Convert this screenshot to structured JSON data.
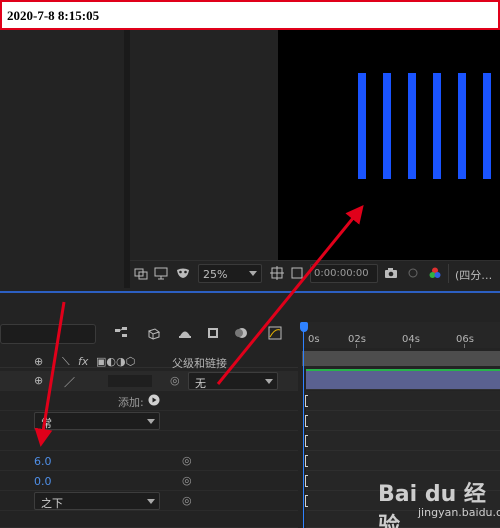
{
  "timestamp": "2020-7-8 8:15:05",
  "colors": {
    "accent": "#2f82ff",
    "stripes": "#1a54ff",
    "annotation": "#e0001a",
    "layer_bar": "#5a6190"
  },
  "viewer": {
    "zoom": "25%",
    "timecode": "0:00:00:00",
    "resolution": "(四分…",
    "stripe_count": 6
  },
  "timeline": {
    "ruler_ticks": [
      "0s",
      "02s",
      "04s",
      "06s"
    ],
    "columns": {
      "parent_link": "父级和链接",
      "fx": "fx"
    },
    "layer": {
      "parent_value": "无"
    },
    "add_label": "添加:",
    "blend_mode": "常",
    "values": [
      "6.0",
      "0.0"
    ],
    "order_value": "之下"
  },
  "watermark": {
    "brand": "Bai du 经验",
    "url": "jingyan.baidu.com"
  }
}
